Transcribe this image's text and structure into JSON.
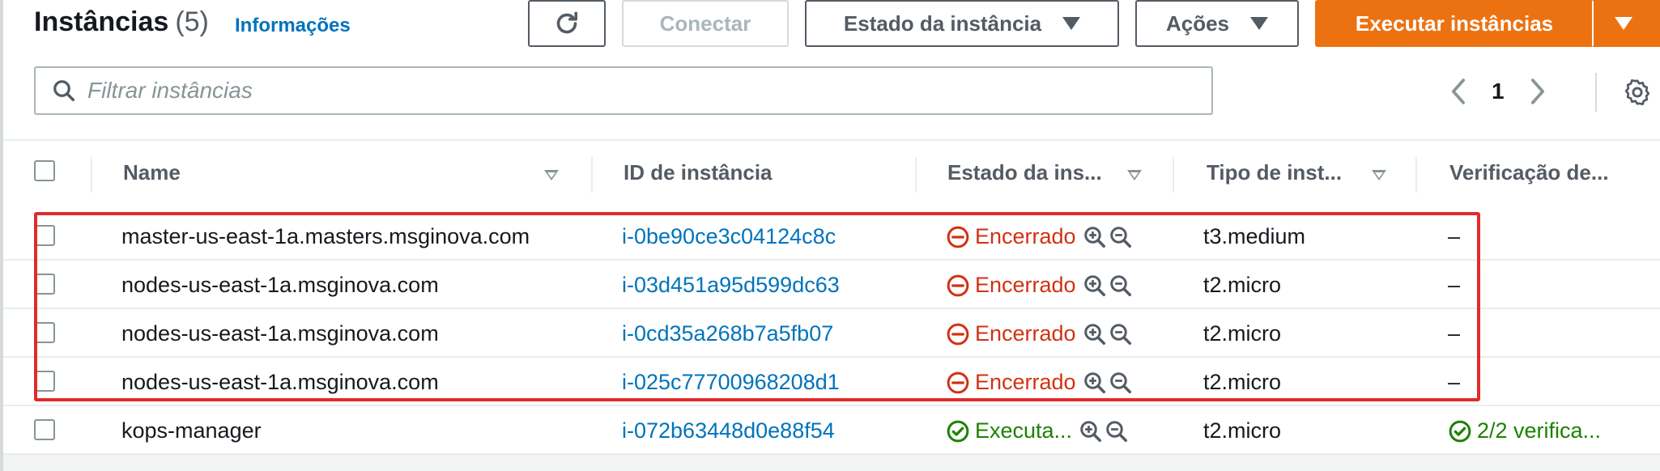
{
  "header": {
    "title": "Instâncias",
    "count": "(5)",
    "info_link": "Informações",
    "connect_label": "Conectar",
    "state_label": "Estado da instância",
    "actions_label": "Ações",
    "launch_label": "Executar instâncias"
  },
  "search": {
    "placeholder": "Filtrar instâncias"
  },
  "pagination": {
    "current_page": "1"
  },
  "columns": {
    "name": "Name",
    "id": "ID de instância",
    "state": "Estado da ins...",
    "type": "Tipo de inst...",
    "check": "Verificação de..."
  },
  "rows": [
    {
      "name": "master-us-east-1a.masters.msginova.com",
      "id": "i-0be90ce3c04124c8c",
      "state": "Encerrado",
      "status": "stopped",
      "type": "t3.medium",
      "check": "–"
    },
    {
      "name": "nodes-us-east-1a.msginova.com",
      "id": "i-03d451a95d599dc63",
      "state": "Encerrado",
      "status": "stopped",
      "type": "t2.micro",
      "check": "–"
    },
    {
      "name": "nodes-us-east-1a.msginova.com",
      "id": "i-0cd35a268b7a5fb07",
      "state": "Encerrado",
      "status": "stopped",
      "type": "t2.micro",
      "check": "–"
    },
    {
      "name": "nodes-us-east-1a.msginova.com",
      "id": "i-025c77700968208d1",
      "state": "Encerrado",
      "status": "stopped",
      "type": "t2.micro",
      "check": "–"
    },
    {
      "name": "kops-manager",
      "id": "i-072b63448d0e88f54",
      "state": "Executa...",
      "status": "running",
      "type": "t2.micro",
      "check": "2/2 verifica..."
    }
  ],
  "colors": {
    "primary_orange": "#ec7211",
    "link_blue": "#0073bb",
    "stopped_red": "#d13212",
    "running_green": "#1d8102",
    "highlight_red": "#e02b2b"
  },
  "icons": {
    "refresh": "refresh-icon",
    "search": "search-icon",
    "prev": "chevron-left-icon",
    "next": "chevron-right-icon",
    "settings": "gear-icon",
    "stopped": "minus-circle-icon",
    "running": "check-circle-icon",
    "zoom_in": "zoom-in-icon",
    "zoom_out": "zoom-out-icon"
  }
}
